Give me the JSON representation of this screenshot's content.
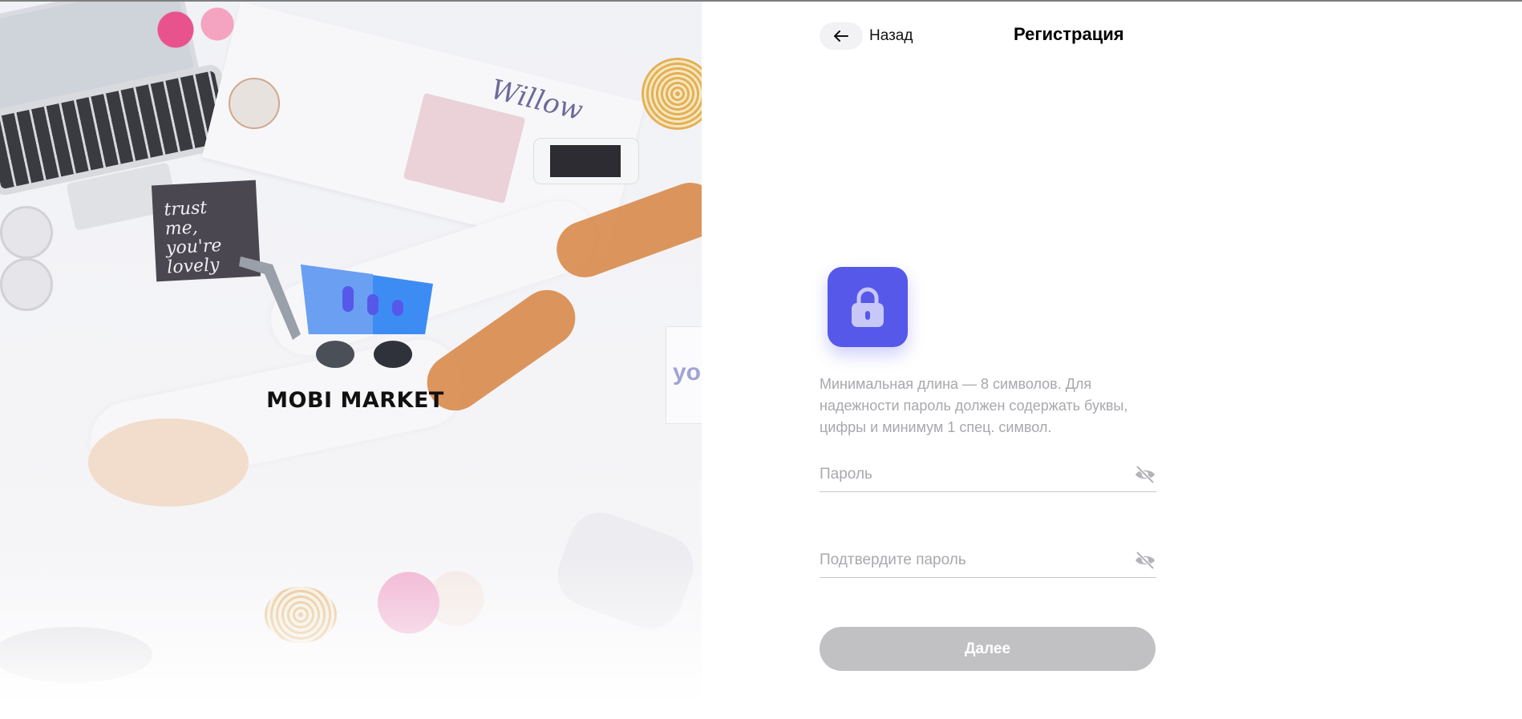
{
  "header": {
    "back_label": "Назад",
    "title": "Регистрация"
  },
  "hero": {
    "brand": "MOBI MARKET",
    "decor": {
      "card_text_1": "trust",
      "card_text_2": "me,",
      "card_text_3": "you're",
      "card_text_4": "lovely",
      "magazine_title": "Willow",
      "note_text": "yo"
    },
    "colors": {
      "cart_blue": "#3d8cf4",
      "cart_bars": "#5558e9",
      "cart_handle": "#9aa0a9",
      "wheel": "#3b3f48"
    }
  },
  "form": {
    "icon": "lock-icon",
    "hint": "Минимальная длина — 8 символов. Для надежности пароль должен содержать буквы, цифры и минимум 1 спец. символ.",
    "password": {
      "placeholder": "Пароль",
      "value": "",
      "toggle_icon": "eye-off-icon"
    },
    "confirm": {
      "placeholder": "Подтвердите пароль",
      "value": "",
      "toggle_icon": "eye-off-icon"
    },
    "submit_label": "Далее"
  },
  "colors": {
    "accent": "#5558e9",
    "button_disabled": "#c1c1c3",
    "hint_text": "#a8a8ad"
  }
}
